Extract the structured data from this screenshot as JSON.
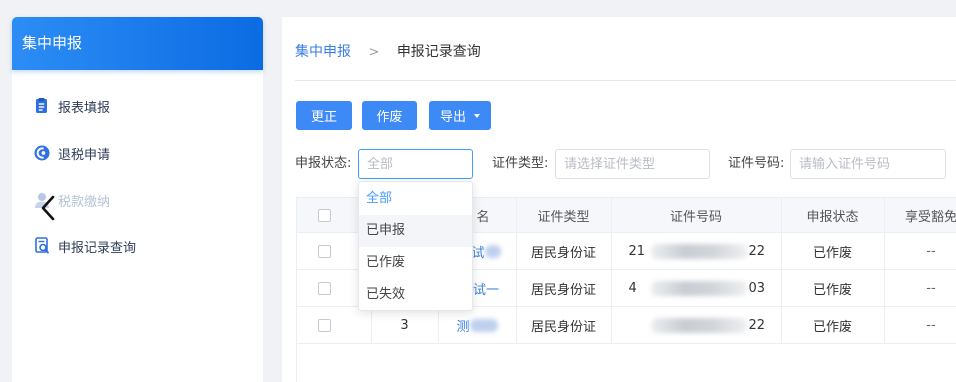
{
  "theme": {
    "primary": "#3d89f5",
    "link": "#3a7ee0",
    "sidebar_header_start": "#2d8df5",
    "sidebar_header_end": "#0b6be3",
    "menu_text": "#2f3d58",
    "disabled_text": "#b6c3d8",
    "border": "#dcdfe6",
    "focus_border": "#409eff",
    "placeholder": "#b8bcc4",
    "table_line": "#ebeef5",
    "table_header_bg": "#f5f7fa",
    "option_hover_bg": "#f3f5f8"
  },
  "sidebar": {
    "title": "集中申报",
    "items": [
      {
        "label": "报表填报",
        "icon": "form-icon"
      },
      {
        "label": "退税申请",
        "icon": "refund-icon"
      },
      {
        "label": "税款缴纳",
        "icon": "user-icon",
        "disabled": true
      },
      {
        "label": "申报记录查询",
        "icon": "record-search-icon"
      }
    ]
  },
  "overlay": {
    "prev_icon": "chevron-left-icon"
  },
  "breadcrumb": {
    "parent": "集中申报",
    "separator": ">",
    "current": "申报记录查询"
  },
  "toolbar": {
    "correct_label": "更正",
    "void_label": "作废",
    "export_label": "导出",
    "export_icon": "caret-down-icon"
  },
  "filters": {
    "status": {
      "label": "申报状态:",
      "display": "全部",
      "open": true,
      "options": [
        "全部",
        "已申报",
        "已作废",
        "已失效"
      ],
      "selected_index": 0,
      "hovered_index": 1
    },
    "id_type": {
      "label": "证件类型:",
      "placeholder": "请选择证件类型"
    },
    "id_number": {
      "label": "证件号码:",
      "placeholder": "请输入证件号码"
    }
  },
  "table": {
    "select_all_checked": false,
    "columns": [
      "",
      "",
      "名",
      "证件类型",
      "证件号码",
      "申报状态",
      "享受豁免"
    ],
    "rows": [
      {
        "checked": false,
        "index": "",
        "name": "试",
        "id_type": "居民身份证",
        "id_number_prefix": "21",
        "id_number_suffix": "22",
        "status": "已作废",
        "exemption": "--"
      },
      {
        "checked": false,
        "index": "",
        "name": "试一",
        "id_type": "居民身份证",
        "id_number_prefix": "4",
        "id_number_suffix": "03",
        "status": "已作废",
        "exemption": "--"
      },
      {
        "checked": false,
        "index": "3",
        "name": "测",
        "id_type": "居民身份证",
        "id_number_prefix": "",
        "id_number_suffix": "22",
        "status": "已作废",
        "exemption": "--"
      }
    ]
  }
}
